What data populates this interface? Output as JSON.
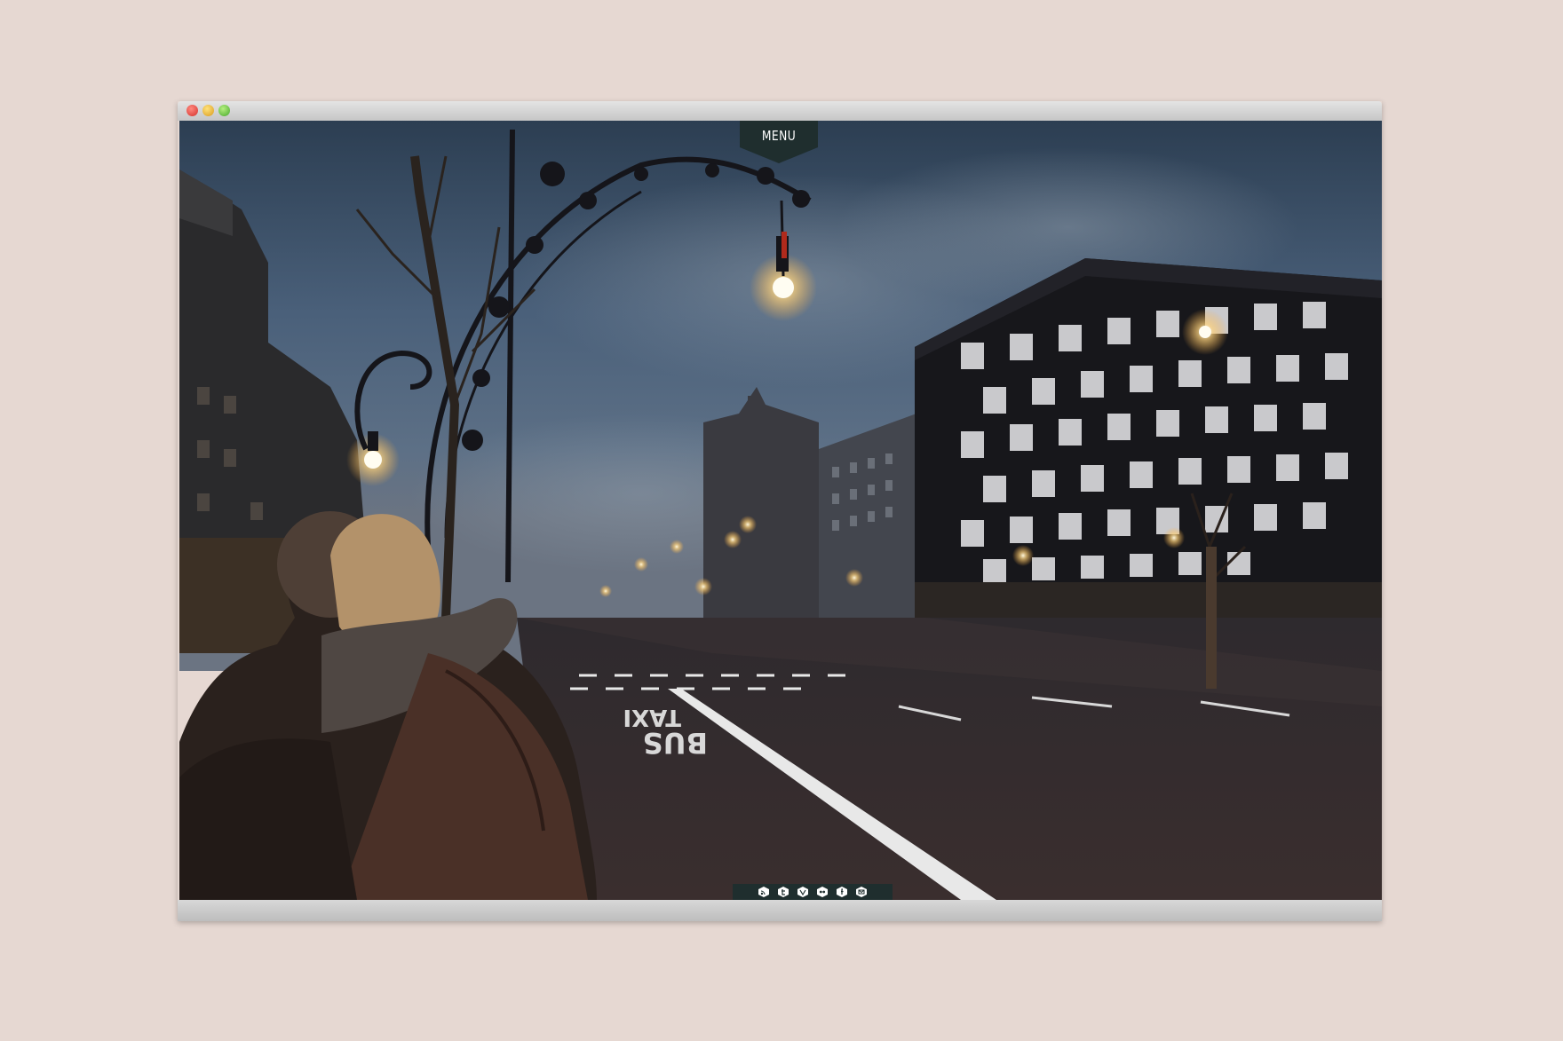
{
  "window": {
    "controls": [
      "close",
      "minimize",
      "zoom"
    ]
  },
  "nav": {
    "menu_label": "MENU"
  },
  "road_markings": [
    "BUS",
    "TAXI"
  ],
  "social": [
    {
      "icon": "rss-icon"
    },
    {
      "icon": "twitter-icon"
    },
    {
      "icon": "vimeo-icon"
    },
    {
      "icon": "flickr-icon"
    },
    {
      "icon": "facebook-icon"
    },
    {
      "icon": "email-icon"
    }
  ],
  "colors": {
    "page_background": "#e6d8d2",
    "menu_tab": "#1f2e2e",
    "social_bar": "#1f2e2e"
  }
}
